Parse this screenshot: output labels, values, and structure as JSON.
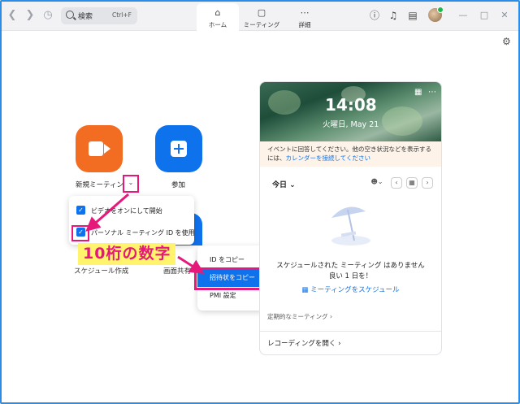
{
  "topbar": {
    "search_placeholder": "検索",
    "search_shortcut": "Ctrl+F",
    "tabs": [
      {
        "label": "ホーム",
        "icon": "home-icon"
      },
      {
        "label": "ミーティング",
        "icon": "video-icon"
      },
      {
        "label": "詳細",
        "icon": "more-icon"
      }
    ]
  },
  "home": {
    "new_meeting_label": "新規ミーティング",
    "join_label": "参加",
    "schedule_label": "スケジュール作成",
    "screen_share_label": "画面共有"
  },
  "new_meeting_menu": {
    "items": [
      {
        "label": "ビデオをオンにして開始",
        "checked": true
      },
      {
        "label": "パーソナル ミーティング ID を使用",
        "checked": true
      }
    ]
  },
  "pmi_menu": {
    "items": [
      {
        "label": "ID をコピー"
      },
      {
        "label": "招待状をコピー"
      },
      {
        "label": "PMI 設定"
      }
    ]
  },
  "annotation": {
    "text": "10桁の数字"
  },
  "calendar": {
    "time": "14:08",
    "date": "火曜日, May 21",
    "notice_text": "イベントに回答してください。他の空き状況などを表示するには、",
    "notice_link": "カレンダーを接続してください",
    "today_label": "今日",
    "empty_line1": "スケジュールされた ミーティング はありません",
    "empty_line2": "良い 1 日を！",
    "schedule_link": "ミーティングをスケジュール",
    "recurring_label": "定期的なミーティング",
    "recording_label": "レコーディングを開く"
  },
  "colors": {
    "accent_blue": "#0e72ed",
    "orange": "#f26d21",
    "annotation_pink": "#e6197a",
    "annotation_yellow": "#fff46b"
  }
}
